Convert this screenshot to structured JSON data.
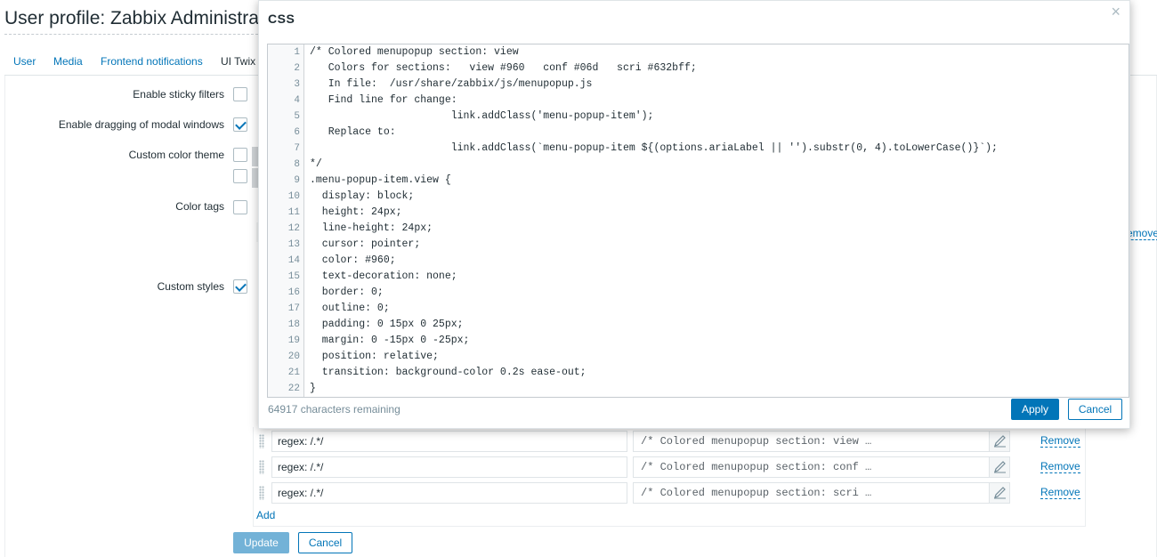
{
  "page": {
    "title": "User profile: Zabbix Administrator"
  },
  "tabs": [
    {
      "label": "User"
    },
    {
      "label": "Media"
    },
    {
      "label": "Frontend notifications"
    },
    {
      "label": "UI Twix"
    }
  ],
  "form": {
    "sticky_filters_label": "Enable sticky filters",
    "sticky_filters_checked": false,
    "drag_modal_label": "Enable dragging of modal windows",
    "drag_modal_checked": true,
    "color_theme_label": "Custom color theme",
    "color_theme_checked": false,
    "color_tags_label": "Color tags",
    "color_tags_checked": false,
    "custom_styles_label": "Custom styles",
    "custom_styles_checked": true,
    "remove_label_partial": "emove"
  },
  "custom_styles": [
    {
      "regex": "regex: /.*/",
      "preview": "/* Colored menupopup section: view …",
      "remove": "Remove"
    },
    {
      "regex": "regex: /.*/",
      "preview": "/* Colored menupopup section: conf …",
      "remove": "Remove"
    },
    {
      "regex": "regex: /.*/",
      "preview": "/* Colored menupopup section: scri …",
      "remove": "Remove"
    }
  ],
  "add_label": "Add",
  "buttons": {
    "update": "Update",
    "cancel": "Cancel"
  },
  "modal": {
    "title": "CSS",
    "close_icon": "×",
    "chars_remaining": "64917 characters remaining",
    "apply": "Apply",
    "cancel": "Cancel",
    "code_lines": [
      "/* Colored menupopup section: view",
      "   Colors for sections:   view #960   conf #06d   scri #632bff;",
      "   In file:  /usr/share/zabbix/js/menupopup.js",
      "   Find line for change:",
      "                       link.addClass('menu-popup-item');",
      "   Replace to:",
      "                       link.addClass(`menu-popup-item ${(options.ariaLabel || '').substr(0, 4).toLowerCase()}`);",
      "*/",
      ".menu-popup-item.view {",
      "  display: block;",
      "  height: 24px;",
      "  line-height: 24px;",
      "  cursor: pointer;",
      "  color: #960;",
      "  text-decoration: none;",
      "  border: 0;",
      "  outline: 0;",
      "  padding: 0 15px 0 25px;",
      "  margin: 0 -15px 0 -25px;",
      "  position: relative;",
      "  transition: background-color 0.2s ease-out;",
      "}"
    ]
  }
}
